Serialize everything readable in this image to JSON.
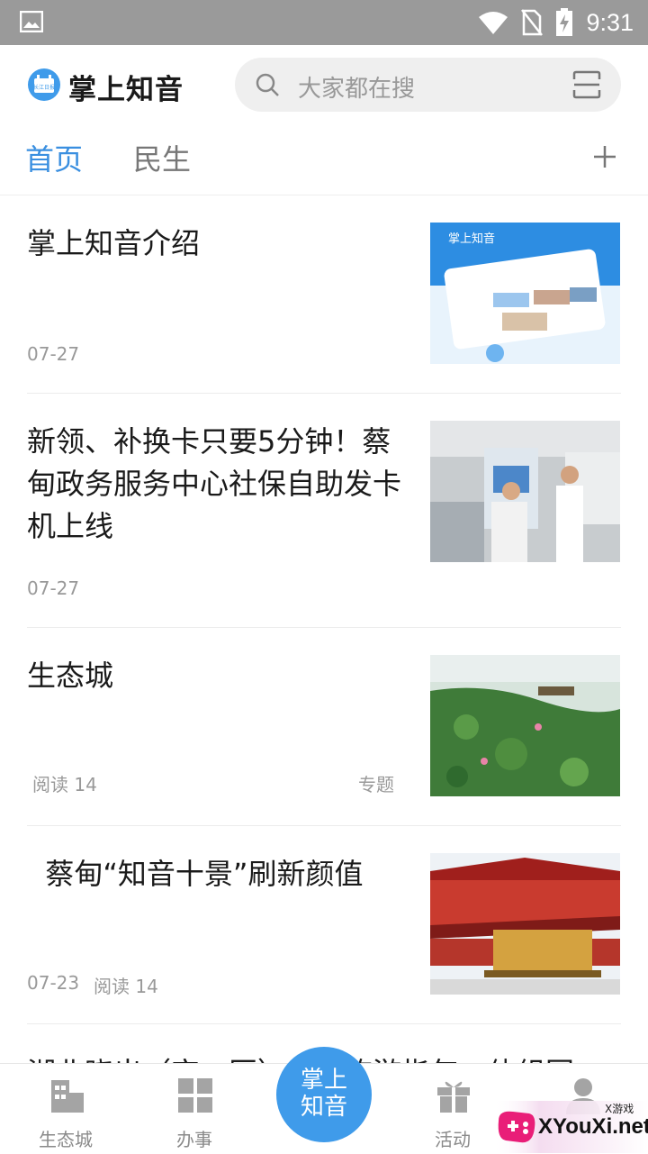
{
  "status_bar": {
    "time": "9:31",
    "icons": [
      "image-icon",
      "wifi-icon",
      "no-sim-icon",
      "battery-charging-icon"
    ]
  },
  "header": {
    "app_title": "掌上知音",
    "logo_badge": "长江日报",
    "search_placeholder": "大家都在搜"
  },
  "tabs": {
    "items": [
      {
        "label": "首页",
        "active": true
      },
      {
        "label": "民生",
        "active": false
      }
    ]
  },
  "news": [
    {
      "title": "掌上知音介绍",
      "date": "07-27",
      "thumb": "app-intro-screenshot"
    },
    {
      "title": "新领、补换卡只要5分钟！蔡甸政务服务中心社保自助发卡机上线",
      "date": "07-27",
      "thumb": "service-center-photo"
    },
    {
      "title": "生态城",
      "reads": "阅读 14",
      "tag": "专题",
      "thumb": "lotus-lake-photo"
    },
    {
      "title": "  蔡甸“知音十景”刷新颜值",
      "date": "07-23",
      "reads": "阅读 14",
      "thumb": "temple-photo"
    }
  ],
  "partial_next_title": "湖北晓出（空一区）……旅游指年一体组团",
  "bottom_nav": {
    "items": [
      {
        "label": "生态城",
        "icon": "building-icon"
      },
      {
        "label": "办事",
        "icon": "grid-icon"
      },
      {
        "label": "活动",
        "icon": "gift-icon"
      },
      {
        "label": "",
        "icon": "user-icon"
      }
    ],
    "center_line1": "掌上",
    "center_line2": "知音"
  },
  "watermark": {
    "text": "XYouXi.net",
    "small": "X游戏"
  },
  "colors": {
    "accent": "#3a8fe0",
    "status_bar": "#9a9a9a",
    "center_button": "#3f9bea"
  }
}
